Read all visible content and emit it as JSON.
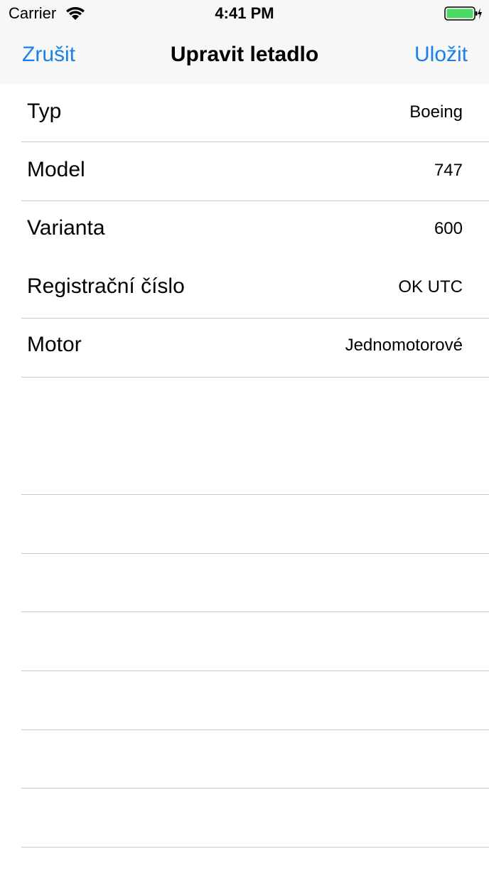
{
  "status_bar": {
    "carrier": "Carrier",
    "time": "4:41 PM",
    "battery_color": "#4cd964"
  },
  "nav": {
    "cancel_label": "Zrušit",
    "title": "Upravit letadlo",
    "save_label": "Uložit",
    "accent_color": "#1a7fe8"
  },
  "rows": [
    {
      "label": "Typ",
      "value": "Boeing"
    },
    {
      "label": "Model",
      "value": "747"
    },
    {
      "label": "Varianta",
      "value": "600"
    },
    {
      "label": "Registrační číslo",
      "value": "OK UTC"
    },
    {
      "label": "Motor",
      "value": "Jednomotorové"
    }
  ]
}
